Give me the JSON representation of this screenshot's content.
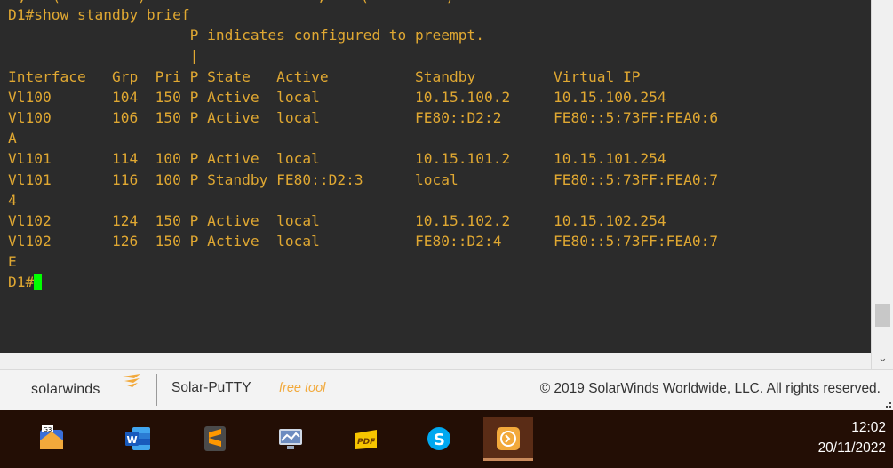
{
  "terminal": {
    "top_cutoff": ",   (         )                    ,    (         )",
    "lines": [
      "D1#show standby brief",
      "                     P indicates configured to preempt.",
      "                     |",
      "Interface   Grp  Pri P State   Active          Standby         Virtual IP",
      "Vl100       104  150 P Active  local           10.15.100.2     10.15.100.254",
      "Vl100       106  150 P Active  local           FE80::D2:2      FE80::5:73FF:FEA0:6",
      "A",
      "Vl101       114  100 P Active  local           10.15.101.2     10.15.101.254",
      "Vl101       116  100 P Standby FE80::D2:3      local           FE80::5:73FF:FEA0:7",
      "4",
      "Vl102       124  150 P Active  local           10.15.102.2     10.15.102.254",
      "Vl102       126  150 P Active  local           FE80::D2:4      FE80::5:73FF:FEA0:7",
      "E"
    ],
    "prompt": "D1#"
  },
  "footer": {
    "brand": "solarwinds",
    "app_name": "Solar-PuTTY",
    "app_tag": "free tool",
    "copyright": "© 2019 SolarWinds Worldwide, LLC. All rights reserved."
  },
  "taskbar": {
    "items": [
      {
        "icon": "gns3-icon"
      },
      {
        "icon": "word-icon"
      },
      {
        "icon": "sublime-text-icon"
      },
      {
        "icon": "network-app-icon"
      },
      {
        "icon": "pdf-reader-icon"
      },
      {
        "icon": "skype-icon"
      },
      {
        "icon": "solar-putty-icon",
        "active": true
      }
    ],
    "time": "12:02",
    "date": "20/11/2022"
  },
  "colors": {
    "terminal_bg": "#2b2b2b",
    "terminal_text": "#e0a832",
    "cursor": "#00ff00",
    "taskbar_bg": "#230e05",
    "brand_accent": "#f2a93b"
  }
}
